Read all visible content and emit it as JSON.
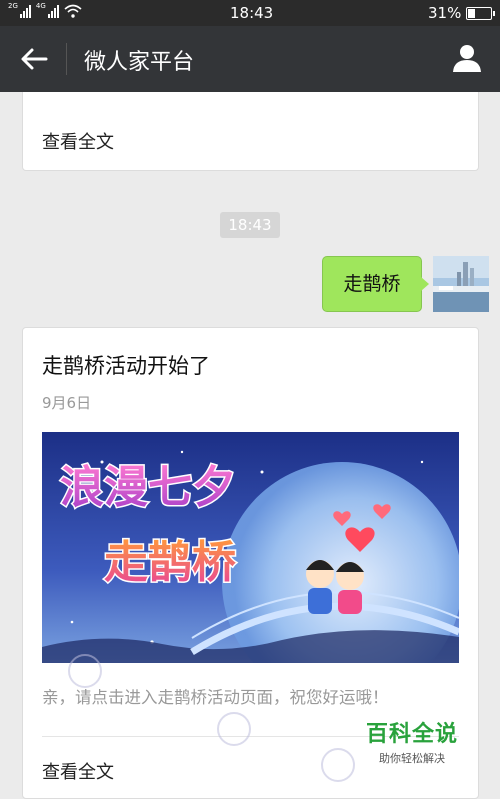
{
  "status_bar": {
    "network_left": "2G",
    "network_right": "4G",
    "time": "18:43",
    "battery_text": "31%",
    "battery_level": 0.31
  },
  "header": {
    "back_icon": "arrow-left-icon",
    "title": "微人家平台",
    "profile_icon": "person-icon"
  },
  "feed": {
    "card1": {
      "read_all": "查看全文"
    },
    "time_chip": "18:43",
    "user_message": {
      "text": "走鹊桥",
      "avatar_icon": "harbor-photo-avatar"
    },
    "card2": {
      "title": "走鹊桥活动开始了",
      "date": "9月6日",
      "cover": {
        "line1": "浪漫七夕",
        "line2": "走鹊桥"
      },
      "description": "亲，请点击进入走鹊桥活动页面，祝您好运哦！",
      "read_all": "查看全文"
    }
  },
  "watermark": {
    "title": "百科全说",
    "subtitle": "助你轻松解决"
  },
  "colors": {
    "titlebar": "#333538",
    "bubble": "#9fe65c",
    "watermark": "#29a23c"
  }
}
